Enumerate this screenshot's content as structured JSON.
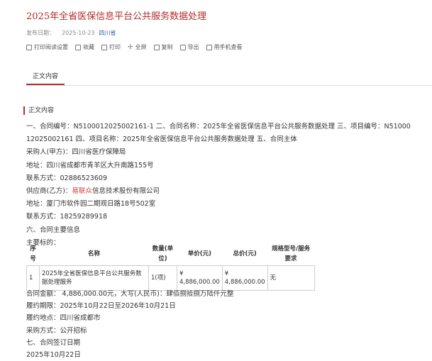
{
  "page": {
    "title": "2025年全省医保信息平台公共服务数据处理",
    "meta": {
      "date_label": "发布日期：",
      "date": "2025-10-23",
      "source": "四川省"
    },
    "toolbar": [
      {
        "label": "打印阅读设置",
        "icon": "settings-icon"
      },
      {
        "label": "收藏",
        "icon": "star-icon"
      },
      {
        "label": "打印",
        "icon": "print-icon"
      },
      {
        "label": "全屏",
        "icon": "fullscreen-icon"
      },
      {
        "label": "复制",
        "icon": "copy-icon"
      },
      {
        "label": "导出",
        "icon": "export-icon"
      },
      {
        "label": "用手机查看",
        "icon": "phone-icon"
      }
    ],
    "tab_label": "正文内容",
    "section_title": "正文内容"
  },
  "content": {
    "line1": "一、合同编号：N5100012025002161-1 二、合同名称：2025年全省医保信息平台公共服务数据处理 三、项目编号：N51000",
    "line2": "12025002161 四、项目名称：2025年全省医保信息平台公共服务数据处理 五、合同主体",
    "buyer": "采购人(甲方)：四川省医疗保障局",
    "buyer_addr": "地址：四川省成都市青羊区大升南路155号",
    "buyer_phone": "联系方式：02886523609",
    "supplier_prefix": "供应商(乙方)：",
    "supplier_highlight": "易联众",
    "supplier_suffix": "信息技术股份有限公司",
    "supplier_addr": "地址：厦门市软件园二期观日路18号502室",
    "supplier_phone": "联系方式：18259289918",
    "section6": "六、合同主要信息",
    "main_subject": "主要标的："
  },
  "table": {
    "headers": {
      "no": "序号",
      "name": "名称",
      "qty": "数量(单位)",
      "unit_price": "单价(元)",
      "total": "总价(元)",
      "spec": "规格型号/服务要求"
    },
    "row": {
      "no": "1",
      "name": "2025年全省医保信息平台公共服务数据处理服务",
      "qty": "1(项)",
      "unit_price": "¥ 4,886,000.00",
      "total": "¥ 4,886,000.00",
      "spec": "无"
    }
  },
  "after": {
    "amount": "合同金额： 4,886,000.00元，大写(人民币)：肆佰捌拾捌万陆仟元整",
    "period": "履约期限：2025年10月22日至2026年10月21日",
    "location": "履约地点：四川省成都市",
    "method": "采购方式：公开招标",
    "section7": "七、合同签订日期",
    "sign_date": "2025年10月22日"
  }
}
